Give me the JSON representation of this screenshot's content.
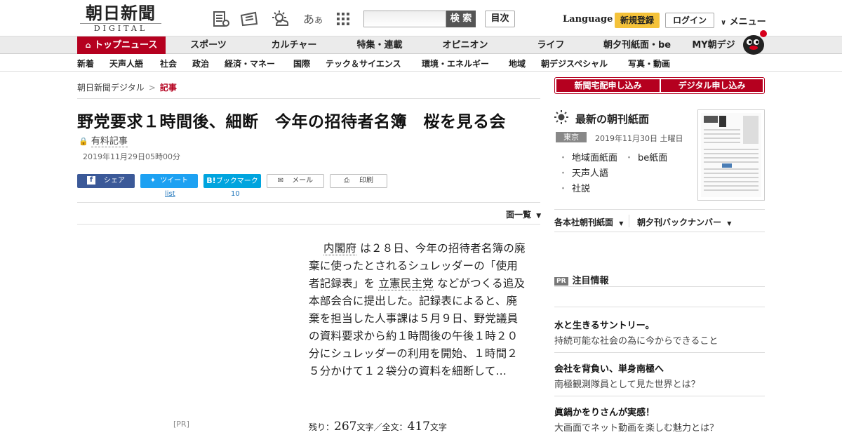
{
  "header": {
    "logo_jp": "朝日新聞",
    "logo_en": "DIGITAL",
    "search_button": "検 索",
    "toc_button": "目次",
    "language": "Language",
    "signup": "新規登録",
    "login": "ログイン",
    "menu": "メニュー"
  },
  "global_nav": [
    "トップニュース",
    "スポーツ",
    "カルチャー",
    "特集・連載",
    "オピニオン",
    "ライフ",
    "朝夕刊紙面・be",
    "MY朝デジ"
  ],
  "sub_nav": [
    "新着",
    "天声人語",
    "社会",
    "政治",
    "経済・マネー",
    "国際",
    "テック＆サイエンス",
    "環境・エネルギー",
    "地域",
    "朝デジスペシャル",
    "写真・動画"
  ],
  "breadcrumb": {
    "home": "朝日新聞デジタル",
    "sep": ">",
    "current": "記事"
  },
  "article": {
    "title": "野党要求１時間後、細断　今年の招待者名簿　桜を見る会",
    "paid_label": "有料記事",
    "date": "2019年11月29日05時00分",
    "share": {
      "facebook": "シェア",
      "twitter": "ツイート",
      "hatena": "ブックマーク",
      "hatena_mark": "B!",
      "mail": "メール",
      "print": "印刷",
      "twitter_count": "list",
      "hatena_count": "10"
    },
    "page_list": "面一覧",
    "body_p1": "内閣府",
    "body_p2": " は２８日、今年の招待者名簿の廃棄に使ったとされるシュレッダーの「使用者記録表」を ",
    "body_p3": "立憲民主党",
    "body_p4": " などがつくる追及本部会合に提出した。記録表によると、廃棄を担当した人事課は５月９日、野党議員の資料要求から約１時間後の午後１時２０分にシュレッダーの利用を開始、１時間２５分かけて１２袋分の資料を細断して…",
    "pr_left": "[PR]",
    "remain_label": "残り：",
    "remain_count": "267",
    "char_unit": "文字",
    "total_label": "／全文：",
    "total_count": "417",
    "char_unit2": "文字"
  },
  "sidebar": {
    "btn_home": "新聞宅配申し込み",
    "btn_digital": "デジタル申し込み",
    "paper_title": "最新の朝刊紙面",
    "region": "東京",
    "paper_date": "2019年11月30日 土曜日",
    "links": [
      "地域面紙面",
      "be紙面",
      "天声人語",
      "社説"
    ],
    "honsha": "各本社朝刊紙面",
    "backnumber": "朝夕刊バックナンバー",
    "pr_badge": "PR",
    "pr_title": "注目情報",
    "ads": [
      {
        "title": "水と生きるサントリー。",
        "sub": "持続可能な社会の為に今からできること"
      },
      {
        "title": "会社を背負い、単身南極へ",
        "sub": "南極観測隊員として見た世界とは？"
      },
      {
        "title": "眞鍋かをりさんが実感！",
        "sub": "大画面でネット動画を楽しむ魅力とは？"
      }
    ]
  },
  "colors": {
    "brand_red": "#b5001f",
    "signup_yellow": "#f4c23a"
  }
}
